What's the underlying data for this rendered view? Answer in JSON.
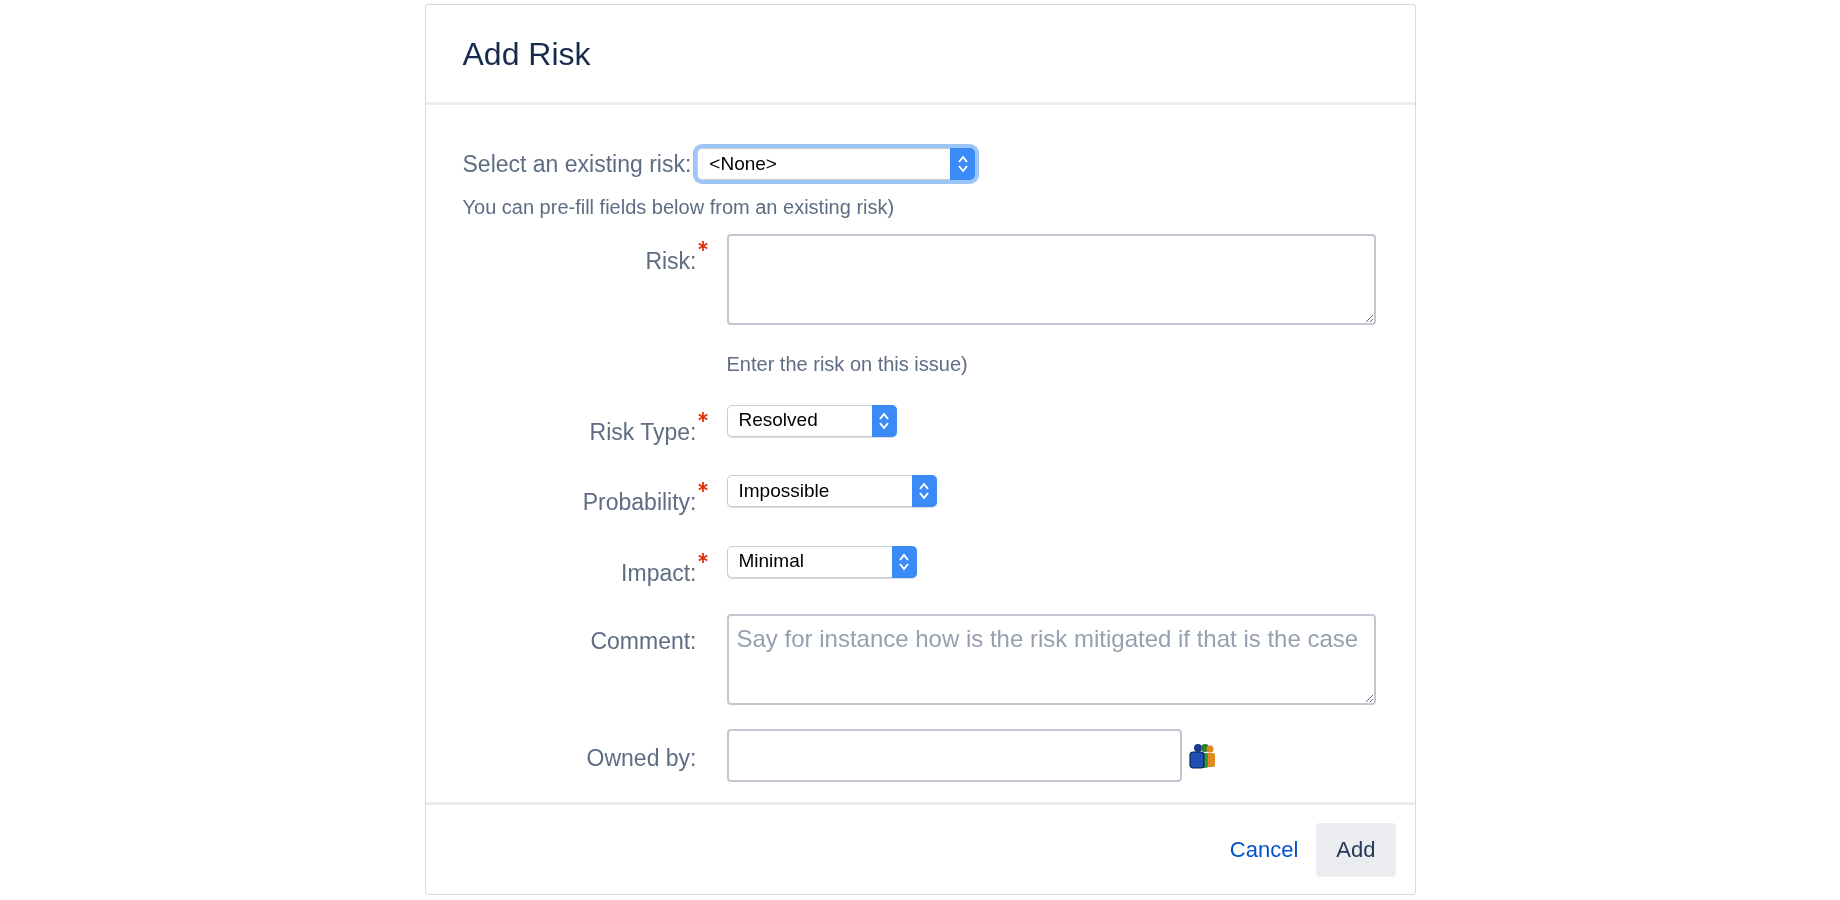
{
  "dialog": {
    "title": "Add Risk"
  },
  "existing_risk": {
    "label": "Select an existing risk:",
    "value": "<None>",
    "focused": true,
    "help": "You can pre-fill fields below from an existing risk)"
  },
  "fields": [
    {
      "kind": "textarea",
      "label": "Risk:",
      "required": true,
      "help": "Enter the risk on this issue)"
    },
    {
      "kind": "select",
      "label": "Risk Type:",
      "required": true,
      "value": "Resolved"
    },
    {
      "kind": "select",
      "label": "Probability:",
      "required": true,
      "value": "Impossible"
    },
    {
      "kind": "select",
      "label": "Impact:",
      "required": true,
      "value": "Minimal"
    },
    {
      "kind": "textarea",
      "label": "Comment:",
      "required": false,
      "placeholder": "Say for instance how is the risk mitigated if that is the case"
    },
    {
      "kind": "user",
      "label": "Owned by:",
      "required": false
    }
  ],
  "buttons": {
    "cancel": "Cancel",
    "submit": "Add"
  }
}
